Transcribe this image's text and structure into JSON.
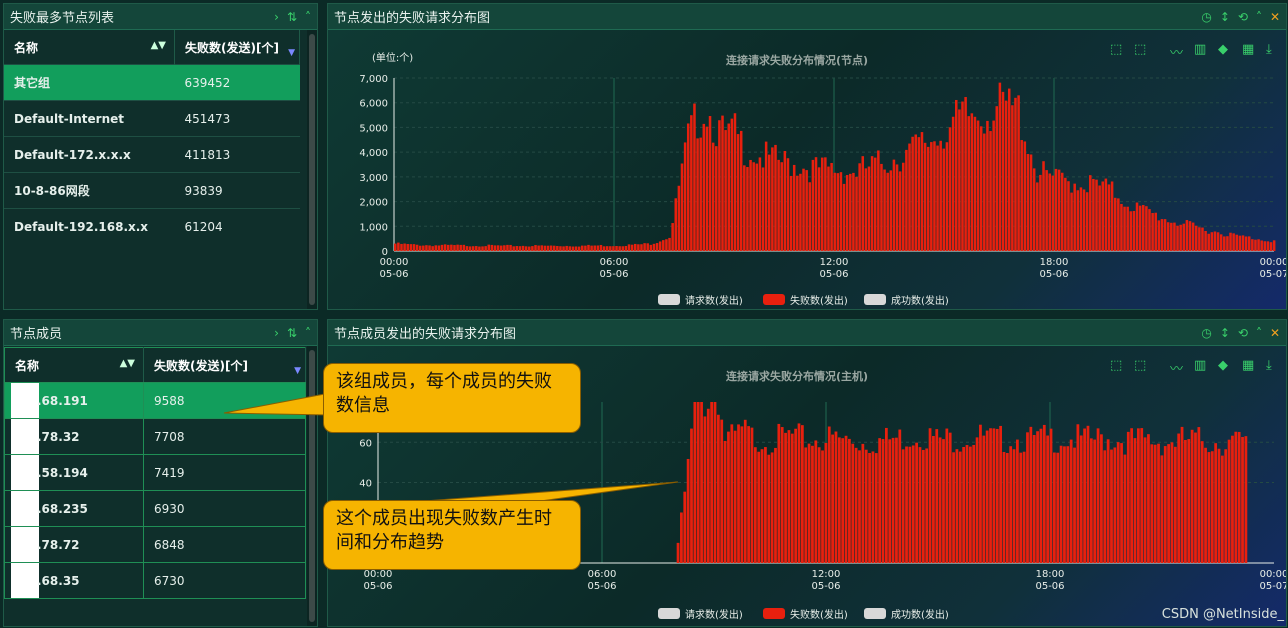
{
  "left_top": {
    "title": "失败最多节点列表",
    "col_name": "名称",
    "col_fail": "失败数(发送)[个]",
    "rows": [
      {
        "name": "其它组",
        "value": "639452"
      },
      {
        "name": "Default-Internet",
        "value": "451473"
      },
      {
        "name": "Default-172.x.x.x",
        "value": "411813"
      },
      {
        "name": "10-8-86网段",
        "value": "93839"
      },
      {
        "name": "Default-192.168.x.x",
        "value": "61204"
      }
    ]
  },
  "left_bottom": {
    "title": "节点成员",
    "col_name": "名称",
    "col_fail": "失败数(发送)[个]",
    "rows": [
      {
        "name": ".68.191",
        "value": "9588"
      },
      {
        "name": ".78.32",
        "value": "7708"
      },
      {
        "name": ".58.194",
        "value": "7419"
      },
      {
        "name": ".68.235",
        "value": "6930"
      },
      {
        "name": ".78.72",
        "value": "6848"
      },
      {
        "name": ".68.35",
        "value": "6730"
      }
    ]
  },
  "header_icons": {
    "expand": "›",
    "sort": "⇅",
    "collapse": "˄",
    "clock": "◷",
    "arrows": "↕",
    "refresh": "⟲",
    "close": "✕"
  },
  "chart_tools": [
    "⬚",
    "⬚",
    "〰",
    "▥",
    "◆",
    "▦",
    "⤓"
  ],
  "top_chart_panel": {
    "title": "节点发出的失败请求分布图",
    "chart_title": "连接请求失败分布情况(节点)",
    "unit": "(单位:个)"
  },
  "bottom_chart_panel": {
    "title": "节点成员发出的失败请求分布图",
    "chart_title": "连接请求失败分布情况(主机)"
  },
  "legend": [
    "请求数(发出)",
    "失败数(发出)",
    "成功数(发出)"
  ],
  "legend_colors": [
    "#d8d8d8",
    "#e8200e",
    "#d8d8d8"
  ],
  "callouts": {
    "one": "该组成员，每个成员的失败数信息",
    "two": "这个成员出现失败数产生时间和分布趋势"
  },
  "watermark": "CSDN @NetInside_",
  "chart_data": [
    {
      "type": "bar",
      "title": "连接请求失败分布情况(节点)",
      "ylabel": "(单位:个)",
      "ylim": [
        0,
        7000
      ],
      "yticks": [
        "0",
        "1,000",
        "2,000",
        "3,000",
        "4,000",
        "5,000",
        "6,000",
        "7,000"
      ],
      "xticks": [
        {
          "time": "00:00",
          "date": "05-06"
        },
        {
          "time": "06:00",
          "date": "05-06"
        },
        {
          "time": "12:00",
          "date": "05-06"
        },
        {
          "time": "18:00",
          "date": "05-06"
        },
        {
          "time": "00:00",
          "date": "05-07"
        }
      ],
      "series": [
        {
          "name": "失败数(发出)",
          "color": "#e8200e",
          "x_hours": [
            0,
            0.5,
            1,
            1.5,
            2,
            2.5,
            3,
            3.5,
            4,
            4.5,
            5,
            5.5,
            6,
            6.5,
            7,
            7.5,
            7.75,
            8,
            8.25,
            8.5,
            8.75,
            9,
            9.25,
            9.5,
            10,
            10.5,
            11,
            11.5,
            12,
            12.5,
            13,
            13.5,
            14,
            14.5,
            15,
            15.5,
            16,
            16.5,
            17,
            17.5,
            18,
            18.5,
            19,
            19.5,
            20,
            20.5,
            21,
            22,
            23,
            24
          ],
          "values": [
            300,
            250,
            230,
            230,
            220,
            220,
            210,
            210,
            210,
            210,
            210,
            220,
            220,
            250,
            300,
            600,
            2700,
            4600,
            5400,
            5800,
            5000,
            4600,
            4800,
            4200,
            3800,
            3600,
            3500,
            3300,
            3300,
            3200,
            3400,
            3700,
            4000,
            4400,
            4900,
            5400,
            5600,
            5800,
            5700,
            3200,
            2900,
            2800,
            2700,
            2500,
            1900,
            1600,
            1300,
            900,
            600,
            400
          ]
        }
      ]
    },
    {
      "type": "bar",
      "title": "连接请求失败分布情况(主机)",
      "yticks": [
        "40",
        "60"
      ],
      "xticks": [
        {
          "time": "00:00",
          "date": "05-06"
        },
        {
          "time": "06:00",
          "date": "05-06"
        },
        {
          "time": "12:00",
          "date": "05-06"
        },
        {
          "time": "18:00",
          "date": "05-06"
        },
        {
          "time": "00:00",
          "date": "05-07"
        }
      ],
      "series": [
        {
          "name": "失败数(发出)",
          "color": "#e8200e",
          "x_hours": [
            8.0,
            8.25,
            8.5,
            8.75,
            9.0,
            9.25,
            9.5,
            9.75,
            10,
            10.5,
            11,
            11.5,
            12,
            12.5,
            13,
            13.5,
            14,
            14.5,
            15,
            15.5,
            16,
            16.5,
            17,
            17.5,
            18,
            18.5,
            19,
            19.5,
            20,
            20.5,
            21,
            21.5,
            22,
            22.5,
            23,
            23.25
          ],
          "values": [
            10,
            45,
            88,
            78,
            91,
            62,
            62,
            66,
            62,
            61,
            63,
            61,
            62,
            61,
            60,
            61,
            62,
            64,
            61,
            62,
            63,
            61,
            62,
            61,
            62,
            62,
            61,
            62,
            61,
            61,
            60,
            61,
            61,
            60,
            60,
            58
          ]
        }
      ]
    }
  ]
}
